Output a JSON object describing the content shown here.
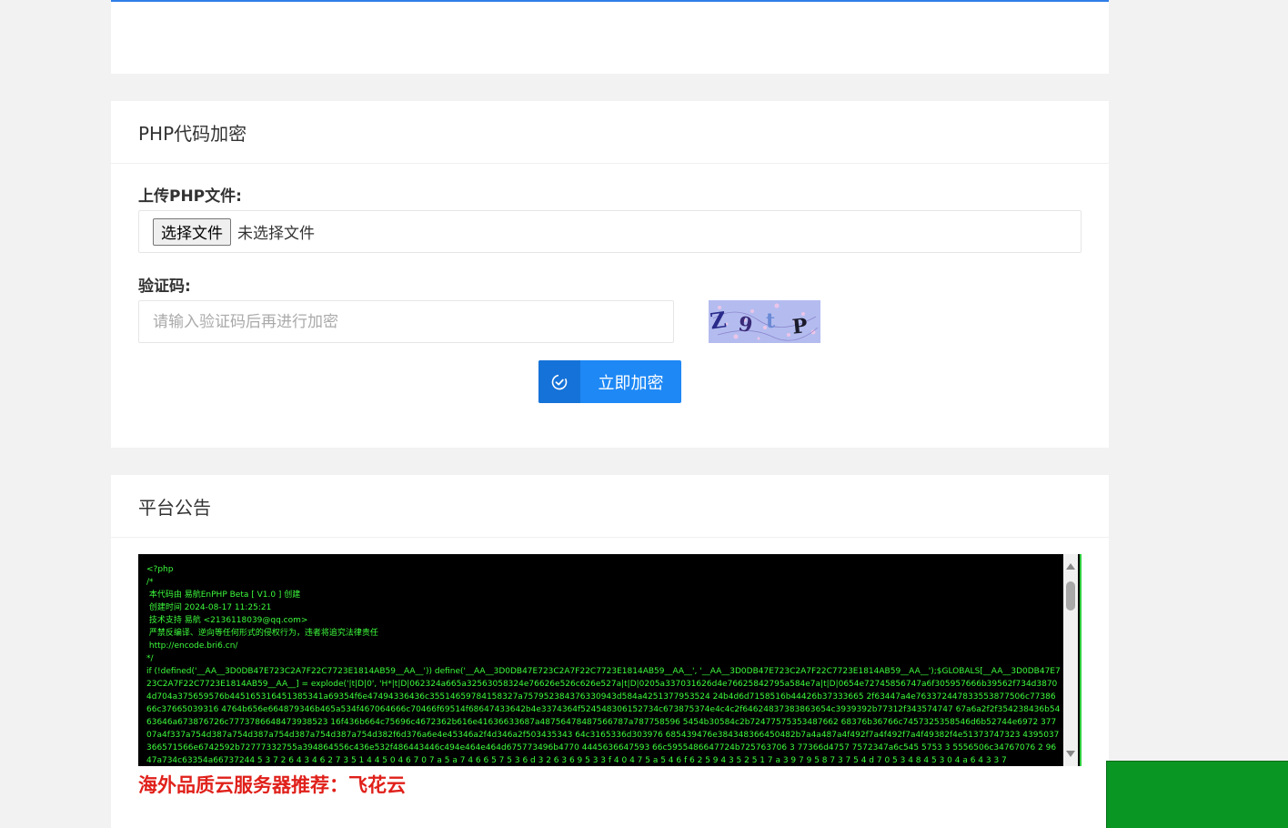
{
  "encrypt_panel": {
    "title": "PHP代码加密",
    "upload_label": "上传PHP文件:",
    "file_button": "选择文件",
    "file_status": "未选择文件",
    "captcha_label": "验证码:",
    "captcha_placeholder": "请输入验证码后再进行加密",
    "captcha_image_text": "Z9tP",
    "submit_label": "立即加密",
    "submit_icon": "check-circle-icon"
  },
  "notice_panel": {
    "title": "平台公告",
    "code_text": "<?php\n/*\n 本代码由 易航EnPHP Beta [ V1.0 ] 创建\n 创建时间 2024-08-17 11:25:21\n 技术支持 易航 <2136118039@qq.com>\n 严禁反编译、逆向等任何形式的侵权行为，违者将追究法律责任\n http://encode.bri6.cn/\n*/\nif (!defined('__AA__3D0DB47E723C2A7F22C7723E1814AB59__AA__')) define('__AA__3D0DB47E723C2A7F22C7723E1814AB59__AA__', '__AA__3D0DB47E723C2A7F22C7723E1814AB59__AA__');$GLOBALS[__AA__3D0DB47E723C2A7F22C7723E1814AB59__AA__] = explode('|t|D|0', 'H*|t|D|062324a665a32563058324e76626e526c626e527a|t|D|0205a337031626d4e76625842795a584e7a|t|D|0654e72745856747a6f305957666b39562f734d38704d704a375659576b445165316451385341a69354f6e47494336436c35514659784158327a757952384376330943d584a4251377953524 24b4d6d7158516b44426b37333665 2f63447a4e763372447833553877506c7738666c37665039316 4764b656e664879346b465a534f467064666c70466f69514f68647433642b4e3374364f524548306152734c673875374e4c4c2f64624837383863654c3939392b77312f343574747 67a6a2f2f354238436b5463646a673876726c7773786648473938523 16f436b664c75696c4672362b616e41636633687a48756478487566787a787758596 5454b30584c2b72477575353487662 68376b36766c7457325358546d6b52744e6972 37707a4f337a754d387a754d387a754d387a754d387a754d382f6d376a6e4e45346a2f4d346a2f503435343 64c3165336d303976 685439476e384348366450482b7a4a487a4f492f7a4f492f7a4f49382f4e51373747323 4395037366571566e6742592b72777332755a394864556c436e532f486443446c494e464e464d675773496b4770 4445636647593 66c5955486647724b725763706 3 77366d4757 7572347a6c545 5753 3 5556506c34767076 2 9647a734c63354a66737244 5 3 7 2 6 4 3 4 6 2 7 3 5 1 4 4 5 0 4 6 7 0 7 a 5 a 7 4 6 6 5 7 5 3 6 d 3 2 6 3 6 9 5 3 3 f 4 0 4 7 5 a 5 4 6 f 6 2 5 9 4 3 5 2 5 1 7 a 3 9 7 9 5 8 7 3 7 5 4 d 7 0 5 3 4 8 4 5 3 0 4 a 6 4 3 3 7",
    "promo_text": "海外品质云服务器推荐：飞花云"
  }
}
